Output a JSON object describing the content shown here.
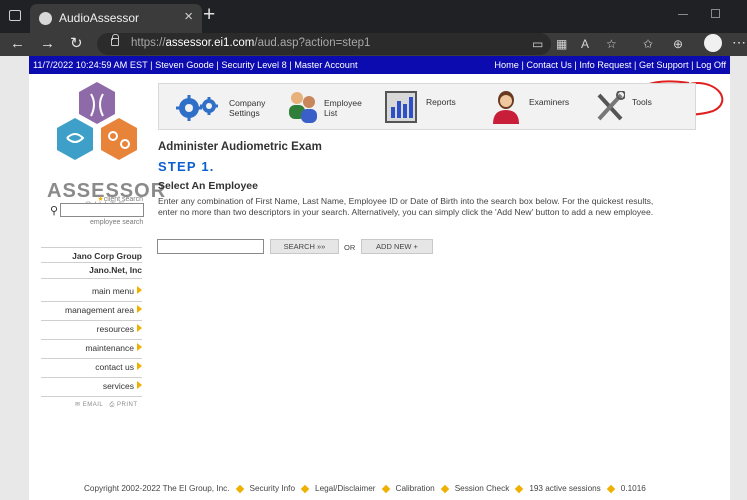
{
  "browser": {
    "tab_title": "AudioAssessor",
    "url_prefix": "https://",
    "url_host": "assessor.ei1.com",
    "url_path": "/aud.asp?action=step1"
  },
  "topbar": {
    "datetime": "11/7/2022 10:24:59 AM EST",
    "user": "Steven Goode",
    "security": "Security Level 8",
    "account": "Master Account",
    "links": [
      "Home",
      "Contact Us",
      "Info Request",
      "Get Support",
      "Log Off"
    ]
  },
  "logo": {
    "name": "ASSESSOR",
    "suite": "SUITE"
  },
  "left": {
    "client_search_label": "client search",
    "employee_search_label": "employee search",
    "org_title": "Jano Corp Group",
    "org_sub": "Jano.Net, Inc",
    "menu": [
      "main menu",
      "management area",
      "resources",
      "maintenance",
      "contact us",
      "services"
    ],
    "email_label": "EMAIL",
    "print_label": "PRINT"
  },
  "iconbar": [
    {
      "label1": "Company",
      "label2": "Settings",
      "icon": "gears-icon"
    },
    {
      "label1": "Employee",
      "label2": "List",
      "icon": "people-icon"
    },
    {
      "label1": "Reports",
      "label2": "",
      "icon": "chart-icon"
    },
    {
      "label1": "Examiners",
      "label2": "",
      "icon": "examiner-icon"
    },
    {
      "label1": "Tools",
      "label2": "",
      "icon": "tools-icon"
    }
  ],
  "main": {
    "title": "Administer Audiometric Exam",
    "step": "STEP 1.",
    "subtitle": "Select An Employee",
    "instructions": "Enter any combination of First Name, Last Name, Employee ID or Date of Birth into the search box below. For the quickest results, enter no more than two descriptors in your search. Alternatively, you can simply click the 'Add New' button to add a new employee.",
    "search_btn": "SEARCH »»",
    "or": "OR",
    "add_btn": "ADD NEW +"
  },
  "footer": {
    "copyright": "Copyright 2002-2022 The EI Group, Inc.",
    "links": [
      "Security Info",
      "Legal/Disclaimer",
      "Calibration",
      "Session Check"
    ],
    "sessions": "193 active sessions",
    "version": "0.1016"
  },
  "colors": {
    "topbar": "#0b0bb0",
    "accent": "#f0b000",
    "step": "#0b5fd0",
    "annotation": "#e02020"
  }
}
